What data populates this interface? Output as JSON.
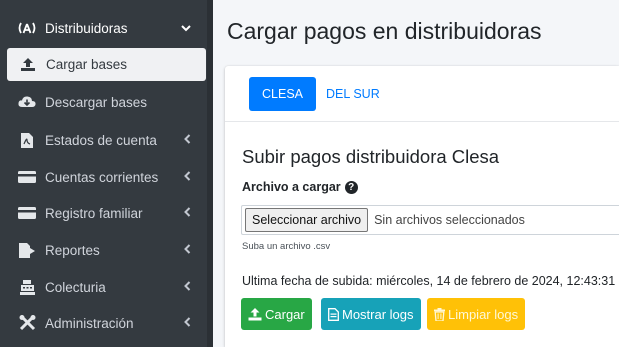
{
  "sidebar": {
    "header": {
      "label": "Distribuidoras",
      "icon": "broadcast-icon"
    },
    "items": [
      {
        "label": "Cargar bases",
        "icon": "upload-icon",
        "active": true
      },
      {
        "label": "Descargar bases",
        "icon": "cloud-download-icon"
      },
      {
        "label": "Estados de cuenta",
        "icon": "file-pdf-icon"
      },
      {
        "label": "Cuentas corrientes",
        "icon": "card-icon"
      },
      {
        "label": "Registro familiar",
        "icon": "card-icon"
      },
      {
        "label": "Reportes",
        "icon": "file-export-icon"
      },
      {
        "label": "Colecturia",
        "icon": "cash-register-icon"
      },
      {
        "label": "Administración",
        "icon": "tools-icon"
      }
    ]
  },
  "page": {
    "title": "Cargar pagos en distribuidoras"
  },
  "tabs": [
    {
      "label": "CLESA",
      "active": true
    },
    {
      "label": "DEL SUR",
      "active": false
    }
  ],
  "form": {
    "section_title": "Subir pagos distribuidora Clesa",
    "file_label": "Archivo a cargar",
    "file_button": "Seleccionar archivo",
    "file_status": "Sin archivos seleccionados",
    "help_text": "Suba un archivo .csv",
    "last_upload": "Ultima fecha de subida: miércoles, 14 de febrero de 2024, 12:43:31"
  },
  "buttons": {
    "upload": "Cargar",
    "show_logs": "Mostrar logs",
    "clear_logs": "Limpiar logs"
  },
  "colors": {
    "sidebar_bg": "#343a40",
    "primary": "#007bff",
    "success": "#28a745",
    "info": "#17a2b8",
    "warning": "#ffc107"
  }
}
